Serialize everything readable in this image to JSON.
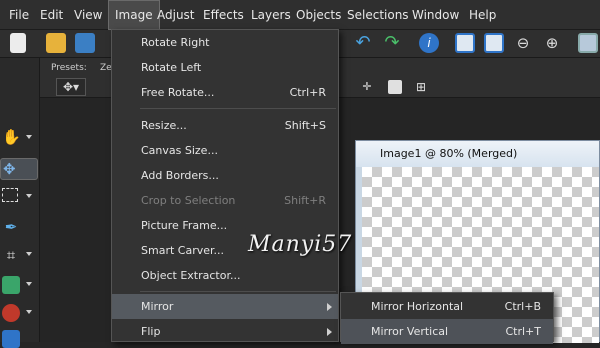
{
  "menubar": {
    "items": [
      "File",
      "Edit",
      "View",
      "Image",
      "Adjust",
      "Effects",
      "Layers",
      "Objects",
      "Selections",
      "Window",
      "Help"
    ],
    "active_index": 3
  },
  "options_strip": {
    "presets_label": "Presets:",
    "zoom_label": "Ze"
  },
  "image_window": {
    "title": "Image1 @  80% (Merged)"
  },
  "image_menu": [
    {
      "label": "Rotate Right",
      "shortcut": ""
    },
    {
      "label": "Rotate Left",
      "shortcut": ""
    },
    {
      "label": "Free Rotate...",
      "shortcut": "Ctrl+R"
    },
    {
      "label": "Resize...",
      "shortcut": "Shift+S"
    },
    {
      "label": "Canvas Size...",
      "shortcut": ""
    },
    {
      "label": "Add Borders...",
      "shortcut": ""
    },
    {
      "label": "Crop to Selection",
      "shortcut": "Shift+R",
      "disabled": true
    },
    {
      "label": "Picture Frame...",
      "shortcut": ""
    },
    {
      "label": "Smart Carver...",
      "shortcut": ""
    },
    {
      "label": "Object Extractor...",
      "shortcut": ""
    },
    {
      "label": "Mirror",
      "shortcut": "",
      "submenu": true,
      "highlighted": true
    },
    {
      "label": "Flip",
      "shortcut": "",
      "submenu": true
    }
  ],
  "mirror_submenu": [
    {
      "label": "Mirror Horizontal",
      "shortcut": "Ctrl+B"
    },
    {
      "label": "Mirror Vertical",
      "shortcut": "Ctrl+T",
      "highlighted": true
    }
  ],
  "watermark": "Manyi57",
  "colors": {
    "menu_bg": "#333333",
    "highlight": "#555a60",
    "app_bg": "#262626",
    "disabled": "#7f7f7f"
  }
}
